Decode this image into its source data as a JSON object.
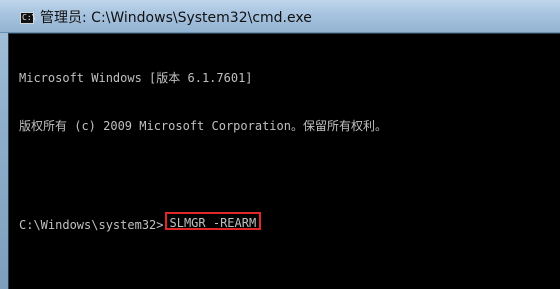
{
  "window": {
    "title": "管理员: C:\\Windows\\System32\\cmd.exe",
    "icon": "cmd-icon"
  },
  "console": {
    "lines": [
      "Microsoft Windows [版本 6.1.7601]",
      "版权所有 (c) 2009 Microsoft Corporation。保留所有权利。"
    ],
    "prompt": "C:\\Windows\\system32>",
    "command": "SLMGR -REARM"
  },
  "colors": {
    "console_background": "#000000",
    "console_text": "#c0c0c0",
    "highlight_border": "#e02828"
  }
}
